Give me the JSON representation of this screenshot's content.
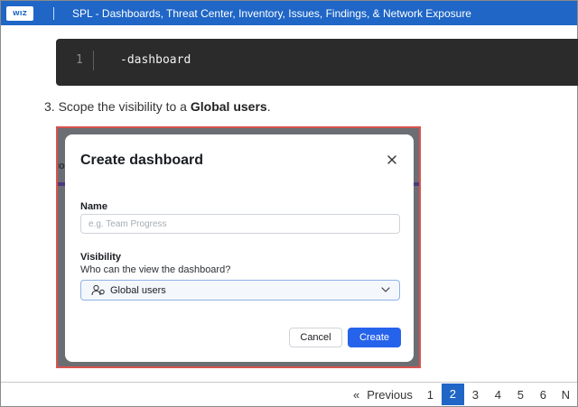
{
  "header": {
    "logo_text": "WIZ",
    "title": "SPL - Dashboards, Threat Center, Inventory, Issues, Findings, & Network Exposure"
  },
  "code": {
    "line_number": "1",
    "text": "-dashboard"
  },
  "step": {
    "prefix": "3. Scope the visibility to a ",
    "bold": "Global users",
    "suffix": "."
  },
  "modal": {
    "title": "Create dashboard",
    "name_label": "Name",
    "name_placeholder": "e.g. Team Progress",
    "visibility_label": "Visibility",
    "visibility_subtitle": "Who can the view the dashboard?",
    "visibility_value": "Global users",
    "cancel_label": "Cancel",
    "create_label": "Create",
    "background_fragment": "io"
  },
  "pagination": {
    "arrows": "«",
    "previous_label": "Previous",
    "pages": [
      "1",
      "2",
      "3",
      "4",
      "5",
      "6",
      "N"
    ],
    "active_page": "2"
  },
  "colors": {
    "header_blue": "#1f66c6",
    "frame_border": "#d9534f",
    "create_button": "#2563eb"
  }
}
